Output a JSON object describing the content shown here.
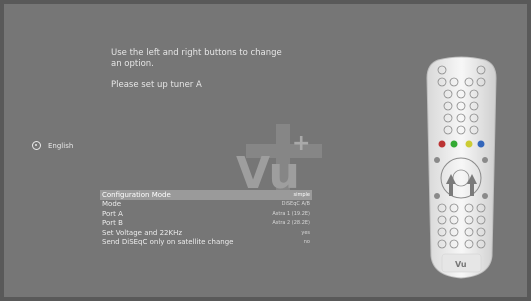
{
  "instructions": {
    "line1": "Use the left and right buttons to change an option.",
    "line2": "Please set up tuner A"
  },
  "language": {
    "label": "English",
    "icon": "globe-icon"
  },
  "logo": {
    "text": "Vu",
    "sup": "+"
  },
  "settings": [
    {
      "label": "Configuration Mode",
      "value": "simple",
      "selected": true
    },
    {
      "label": "Mode",
      "value": "DiSEqC A/B",
      "selected": false
    },
    {
      "label": "Port A",
      "value": "Astra 1 (19.2E)",
      "selected": false
    },
    {
      "label": "Port B",
      "value": "Astra 2 (28.2E)",
      "selected": false
    },
    {
      "label": "Set Voltage and 22KHz",
      "value": "yes",
      "selected": false
    },
    {
      "label": "Send DiSEqC only on satellite change",
      "value": "no",
      "selected": false
    }
  ],
  "remote": {
    "brand": "Vu"
  },
  "colors": {
    "background": "#767676",
    "selected_row": "#9a9a9a",
    "text": "#ececec"
  }
}
